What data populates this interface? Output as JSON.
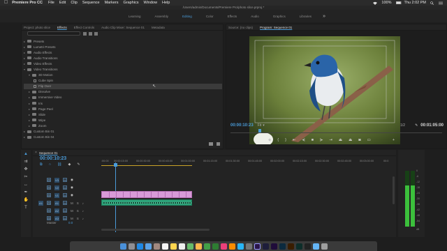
{
  "menubar": {
    "app_name": "Premiere Pro CC",
    "items": [
      "File",
      "Edit",
      "Clip",
      "Sequence",
      "Markers",
      "Graphics",
      "Window",
      "Help"
    ],
    "battery": "100%",
    "clock": "Thu 2:02 PM"
  },
  "path": "/Users/admin/Documents/Premiere Pro/photo slice.prproj *",
  "workspaces": {
    "items": [
      "Learning",
      "Assembly",
      "Editing",
      "Color",
      "Effects",
      "Audio",
      "Graphics",
      "Libraries"
    ],
    "active": "Editing",
    "more": "»"
  },
  "effects_panel": {
    "tabs": [
      "Project: photo slice",
      "Effects",
      "Effect Controls",
      "Audio Clip Mixer: Sequence 01",
      "Metadata"
    ],
    "active_tab": "Effects",
    "tree": [
      {
        "label": "Presets",
        "level": 0,
        "type": "folder"
      },
      {
        "label": "Lumetri Presets",
        "level": 0,
        "type": "folder"
      },
      {
        "label": "Audio Effects",
        "level": 0,
        "type": "folder"
      },
      {
        "label": "Audio Transitions",
        "level": 0,
        "type": "folder"
      },
      {
        "label": "Video Effects",
        "level": 0,
        "type": "folder"
      },
      {
        "label": "Video Transitions",
        "level": 0,
        "type": "folder-open"
      },
      {
        "label": "3D Motion",
        "level": 1,
        "type": "folder-open"
      },
      {
        "label": "Cube Spin",
        "level": 2,
        "type": "item"
      },
      {
        "label": "Flip Over",
        "level": 2,
        "type": "item",
        "selected": true
      },
      {
        "label": "Dissolve",
        "level": 1,
        "type": "folder"
      },
      {
        "label": "Immersive Video",
        "level": 1,
        "type": "folder"
      },
      {
        "label": "Iris",
        "level": 1,
        "type": "folder"
      },
      {
        "label": "Page Peel",
        "level": 1,
        "type": "folder"
      },
      {
        "label": "Slide",
        "level": 1,
        "type": "folder"
      },
      {
        "label": "Wipe",
        "level": 1,
        "type": "folder"
      },
      {
        "label": "Zoom",
        "level": 1,
        "type": "folder"
      },
      {
        "label": "Custom Bin 01",
        "level": 0,
        "type": "folder"
      },
      {
        "label": "Custom Bin 04",
        "level": 0,
        "type": "folder"
      }
    ]
  },
  "program_monitor": {
    "tabs": [
      "Source: (no clips)",
      "Program: Sequence 01"
    ],
    "active_tab": "Program: Sequence 01",
    "current_timecode": "00:00:10:23",
    "fit": "Fit",
    "resolution": "1/2",
    "duration": "00:01:05:00"
  },
  "timeline": {
    "sequence_name": "Sequence 01",
    "timecode": "00:00:10:23",
    "ruler": [
      ":00:00",
      "00:00:15:00",
      "00:00:30:00",
      "00:00:45:00",
      "00:01:00:00",
      "00:01:15:00",
      "00:01:30:00",
      "00:01:45:00",
      "00:02:00:00",
      "00:02:15:00",
      "00:02:30:00",
      "00:02:45:00",
      "00:03:00:00",
      "00:0"
    ],
    "video_tracks": [
      "V3",
      "V2",
      "V1"
    ],
    "audio_tracks": [
      "A1",
      "A2",
      "A3"
    ],
    "source_patch_video": "V1",
    "source_patch_audio": "A1",
    "master_label": "Master",
    "master_value": "0.0"
  },
  "meters": {
    "db_labels": [
      "0",
      "-6",
      "-12",
      "-18",
      "-24",
      "-30",
      "-36",
      "-42",
      "-48",
      "-54",
      "dB"
    ],
    "left_level": 0.74,
    "right_level": 0.74
  },
  "colors": {
    "accent": "#4a9bd8",
    "video_clip": "#d89ad8",
    "audio_clip": "#2ea37a",
    "in_out_bar": "#c9a227"
  }
}
